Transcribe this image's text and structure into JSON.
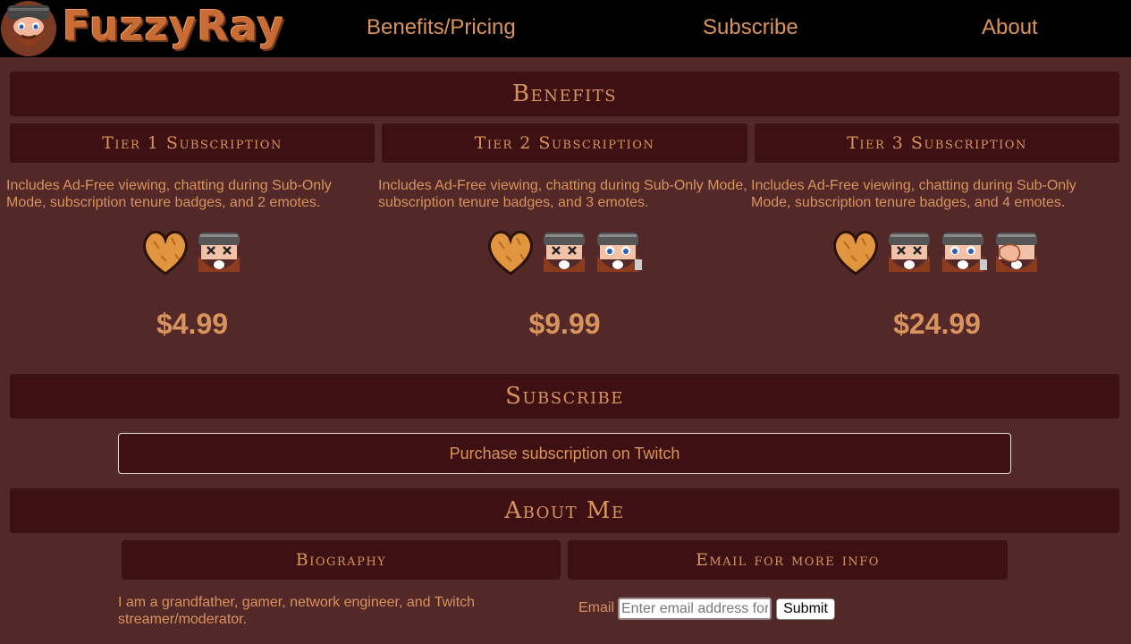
{
  "nav": {
    "logo_text": "FuzzyRay",
    "links": [
      "Benefits/Pricing",
      "Subscribe",
      "About"
    ]
  },
  "benefits": {
    "heading": "Benefits",
    "tiers": [
      {
        "title": "Tier 1 Subscription",
        "description": "Includes Ad-Free viewing, chatting during Sub-Only Mode, subscription tenure badges, and 2 emotes.",
        "emotes": [
          "heart-emote",
          "x-eyes-emote"
        ],
        "price": "$4.99"
      },
      {
        "title": "Tier 2 Subscription",
        "description": "Includes Ad-Free viewing, chatting during Sub-Only Mode, subscription tenure badges, and 3 emotes.",
        "emotes": [
          "heart-emote",
          "x-eyes-emote",
          "big-eyes-emote"
        ],
        "price": "$9.99"
      },
      {
        "title": "Tier 3 Subscription",
        "description": "Includes Ad-Free viewing, chatting during Sub-Only Mode, subscription tenure badges, and 4 emotes.",
        "emotes": [
          "heart-emote",
          "x-eyes-emote",
          "big-eyes-emote",
          "facepalm-emote"
        ],
        "price": "$24.99"
      }
    ]
  },
  "subscribe": {
    "heading": "Subscribe",
    "button_label": "Purchase subscription on Twitch"
  },
  "about": {
    "heading": "About Me",
    "bio_heading": "Biography",
    "bio_text": "I am a grandfather, gamer, network engineer, and Twitch streamer/moderator.",
    "email_heading": "Email for more info",
    "email_label": "Email",
    "email_placeholder": "Enter email address for",
    "submit_label": "Submit"
  },
  "colors": {
    "page_bg": "#522828",
    "bar_bg": "#3d1113",
    "text": "#d9935c",
    "nav_bg": "#000000"
  }
}
